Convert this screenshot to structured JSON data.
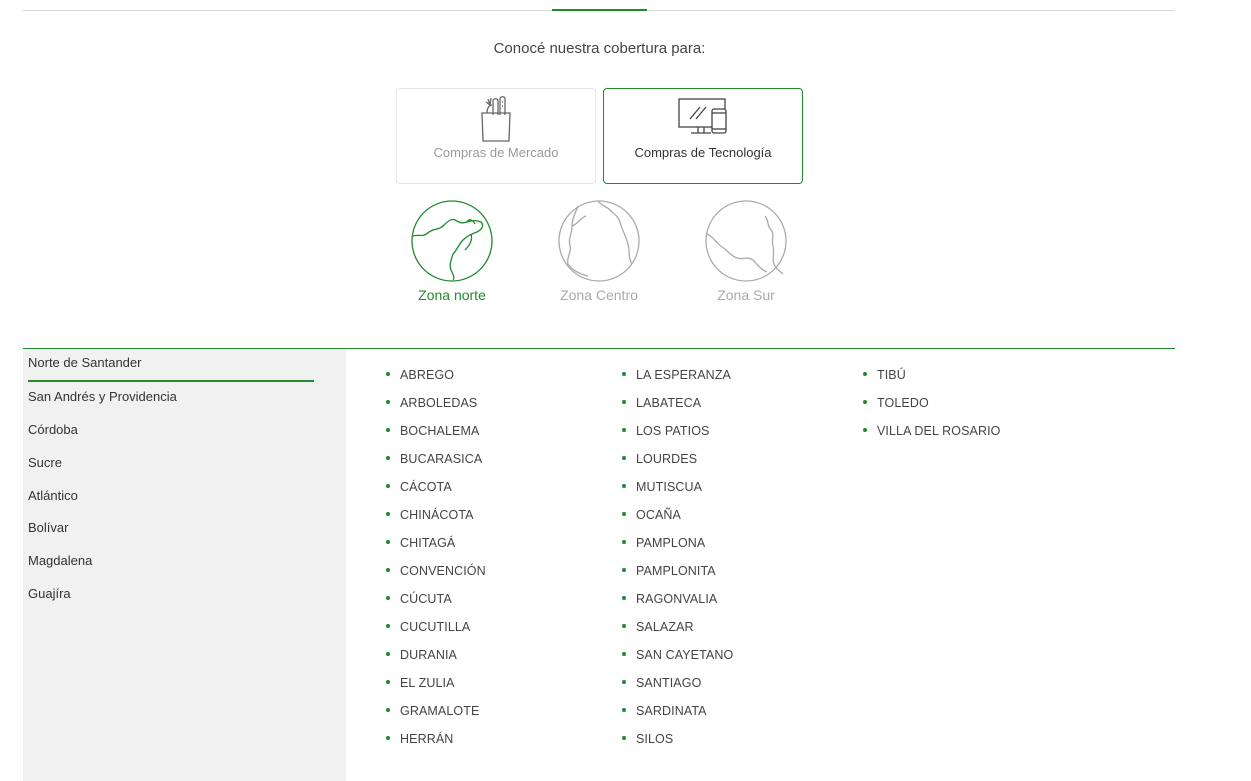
{
  "intro_text": "Conocé nuestra cobertura para:",
  "purchase_types": [
    {
      "label": "Compras de Mercado",
      "icon": "grocery-bag-icon",
      "active": false
    },
    {
      "label": "Compras de Tecnología",
      "icon": "computer-phone-icon",
      "active": true
    }
  ],
  "zones": [
    {
      "label": "Zona norte",
      "icon": "map-north-icon",
      "active": true
    },
    {
      "label": "Zona Centro",
      "icon": "map-center-icon",
      "active": false
    },
    {
      "label": "Zona Sur",
      "icon": "map-south-icon",
      "active": false
    }
  ],
  "departments": [
    "Norte de Santander",
    "San Andrés y Providencia",
    "Córdoba",
    "Sucre",
    "Atlántico",
    "Bolívar",
    "Magdalena",
    "Guajíra"
  ],
  "selected_department": "Norte de Santander",
  "municipalities": [
    [
      "ABREGO",
      "ARBOLEDAS",
      "BOCHALEMA",
      "BUCARASICA",
      "CÁCOTA",
      "CHINÁCOTA",
      "CHITAGÁ",
      "CONVENCIÓN",
      "CÚCUTA",
      "CUCUTILLA",
      "DURANIA",
      "EL ZULIA",
      "GRAMALOTE",
      "HERRÁN"
    ],
    [
      "LA ESPERANZA",
      "LABATECA",
      "LOS PATIOS",
      "LOURDES",
      "MUTISCUA",
      "OCAÑA",
      "PAMPLONA",
      "PAMPLONITA",
      "RAGONVALIA",
      "SALAZAR",
      "SAN CAYETANO",
      "SANTIAGO",
      "SARDINATA",
      "SILOS"
    ],
    [
      "TIBÚ",
      "TOLEDO",
      "VILLA DEL ROSARIO"
    ]
  ],
  "colors": {
    "accent": "#1f8a2e",
    "sidebar_bg": "#f1f1f1",
    "inactive_text": "#aaaaaa"
  }
}
